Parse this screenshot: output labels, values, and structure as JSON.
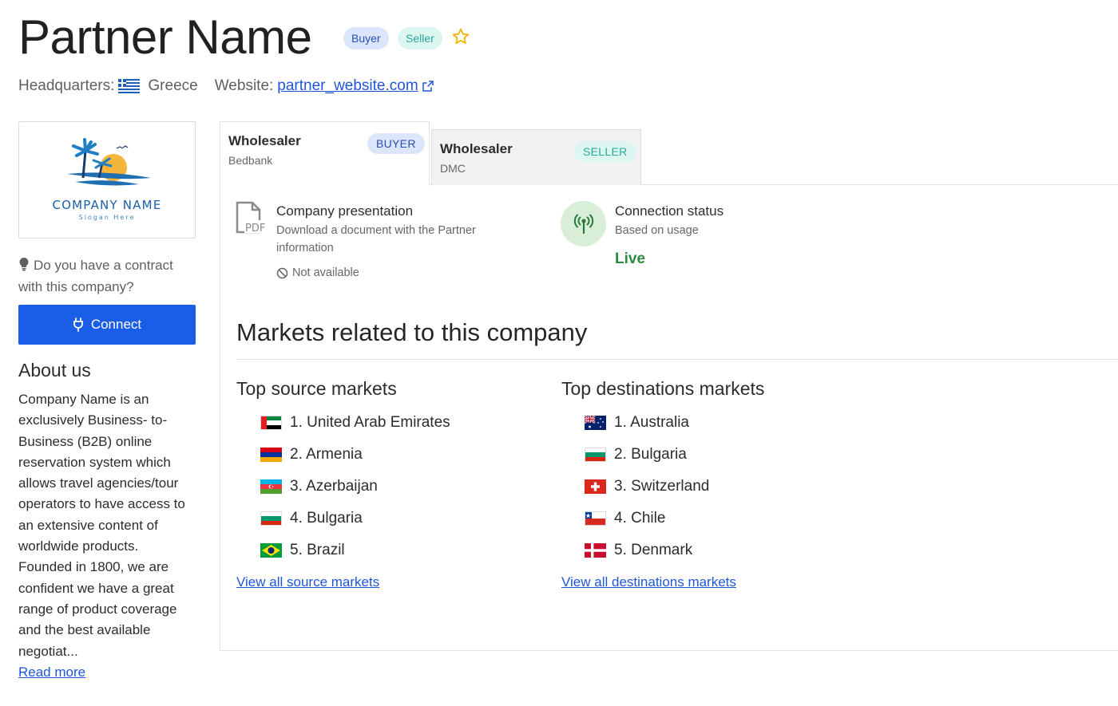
{
  "header": {
    "title": "Partner Name",
    "badges": {
      "buyer": "Buyer",
      "seller": "Seller"
    },
    "favorite_icon": "star-outline-icon",
    "hq_label": "Headquarters:",
    "hq_country": "Greece",
    "website_label": "Website:",
    "website_link": "partner_website.com"
  },
  "logo": {
    "name": "COMPANY NAME",
    "slogan": "Slogan Here"
  },
  "sidebar": {
    "contract_question": "Do you have a contract with this company?",
    "connect_label": "Connect",
    "about_title": "About us",
    "about_text": "Company Name is an exclusively Business- to-Business (B2B) online reservation system which allows travel agencies/tour operators to have access to an extensive content of worldwide products. Founded in 1800, we are confident we have a great range of product coverage and the best available negotiat...",
    "read_more": "Read more"
  },
  "tabs": [
    {
      "title": "Wholesaler",
      "subtitle": "Bedbank",
      "badge": "BUYER",
      "active": true
    },
    {
      "title": "Wholesaler",
      "subtitle": "DMC",
      "badge": "SELLER",
      "active": false
    }
  ],
  "presentation": {
    "title": "Company presentation",
    "description": "Download a document with the Partner information",
    "status": "Not available",
    "icon_label": "PDF"
  },
  "connection": {
    "title": "Connection status",
    "subtitle": "Based on usage",
    "value": "Live"
  },
  "markets": {
    "title": "Markets related to this company",
    "source_title": "Top source markets",
    "destination_title": "Top destinations markets",
    "source": [
      {
        "label": "1. United Arab Emirates",
        "flag": "uae-flag-icon"
      },
      {
        "label": "2. Armenia",
        "flag": "armenia-flag-icon"
      },
      {
        "label": "3. Azerbaijan",
        "flag": "azerbaijan-flag-icon"
      },
      {
        "label": "4. Bulgaria",
        "flag": "bulgaria-flag-icon"
      },
      {
        "label": "5. Brazil",
        "flag": "brazil-flag-icon"
      }
    ],
    "destination": [
      {
        "label": "1. Australia",
        "flag": "australia-flag-icon"
      },
      {
        "label": "2. Bulgaria",
        "flag": "bulgaria-flag-icon"
      },
      {
        "label": "3. Switzerland",
        "flag": "switzerland-flag-icon"
      },
      {
        "label": "4. Chile",
        "flag": "chile-flag-icon"
      },
      {
        "label": "5. Denmark",
        "flag": "denmark-flag-icon"
      }
    ],
    "view_all_source": "View all source markets",
    "view_all_destination": "View all destinations markets"
  },
  "colors": {
    "primary": "#1a5de6",
    "link": "#1f56d8",
    "live": "#2a8a3f",
    "star": "#f0b400"
  }
}
